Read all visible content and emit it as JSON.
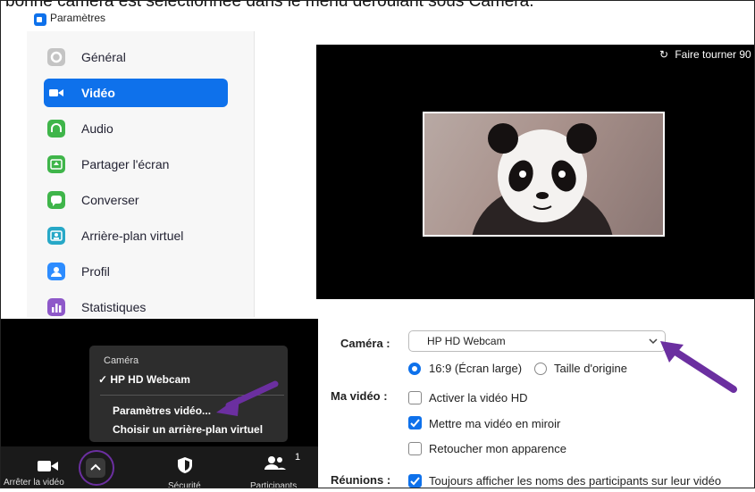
{
  "caption": {
    "text": "bonne caméra est sélectionnée dans le menu déroulant sous Caméra."
  },
  "window": {
    "title": "Paramètres"
  },
  "sidebar": {
    "items": [
      {
        "label": "Général",
        "icon": "gear-icon",
        "color": "#c4c4c4"
      },
      {
        "label": "Vidéo",
        "icon": "video-camera-icon",
        "color": "#0e71eb",
        "active": true
      },
      {
        "label": "Audio",
        "icon": "headphones-icon",
        "color": "#3fb54a"
      },
      {
        "label": "Partager l'écran",
        "icon": "share-screen-icon",
        "color": "#3fb54a"
      },
      {
        "label": "Converser",
        "icon": "chat-icon",
        "color": "#3fb54a"
      },
      {
        "label": "Arrière-plan virtuel",
        "icon": "virtual-background-icon",
        "color": "#27a8c7"
      },
      {
        "label": "Profil",
        "icon": "profile-icon",
        "color": "#2d8cff"
      },
      {
        "label": "Statistiques",
        "icon": "statistics-icon",
        "color": "#8e58c9"
      }
    ]
  },
  "preview": {
    "rotate_label": "Faire tourner 90"
  },
  "form": {
    "camera_label": "Caméra :",
    "camera_value": "HP HD Webcam",
    "ratio_169": "16:9 (Écran large)",
    "ratio_original": "Taille d'origine",
    "my_video_label": "Ma vidéo :",
    "hd_label": "Activer la vidéo HD",
    "mirror_label": "Mettre ma vidéo en miroir",
    "retouch_label": "Retoucher mon apparence",
    "meetings_label": "Réunions :",
    "show_names_label": "Toujours afficher les noms des participants sur leur vidéo"
  },
  "popup": {
    "title": "Caméra",
    "camera_item": "HP HD Webcam",
    "video_settings": "Paramètres vidéo...",
    "choose_background": "Choisir un arrière-plan virtuel"
  },
  "toolbar": {
    "stop_video": "Arrêter la vidéo",
    "security": "Sécurité",
    "participants": "Participants",
    "participants_count": "1"
  },
  "accent": "#0e71eb",
  "arrow_color": "#6b2fa0"
}
